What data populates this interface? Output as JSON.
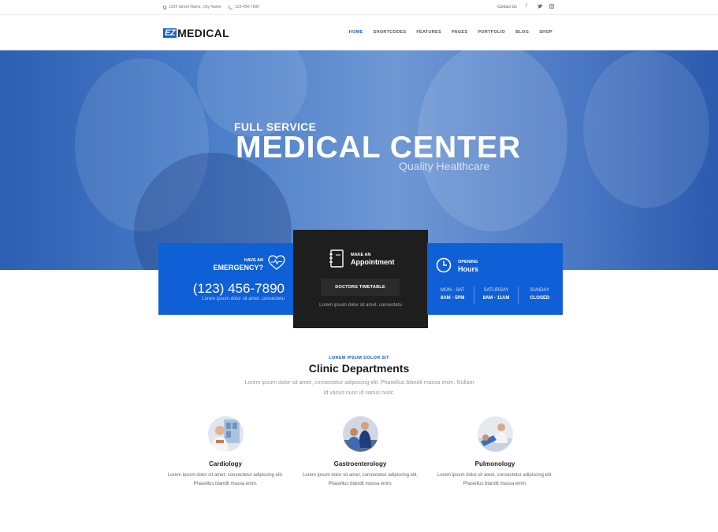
{
  "topbar": {
    "address": "1234 Street Name, City Name",
    "phone": "123-456-7890",
    "contact_label": "Contact Us",
    "social_icons": [
      "facebook-icon",
      "twitter-icon",
      "instagram-icon"
    ]
  },
  "header": {
    "logo_ez": "EZ",
    "logo_medical": "MEDICAL",
    "nav": [
      "HOME",
      "SHORTCODES",
      "FEATURES",
      "PAGES",
      "PORTFOLIO",
      "BLOG",
      "SHOP"
    ],
    "active_nav": "HOME"
  },
  "hero": {
    "subtitle": "FULL SERVICE",
    "title": "MEDICAL CENTER",
    "tagline": "Quality Healthcare"
  },
  "emergency": {
    "small": "HAVE AN",
    "big": "EMERGENCY?",
    "phone": "(123) 456-7890",
    "text": "Lorem ipsum dolor sit amet, consectetu"
  },
  "appointment": {
    "small": "MAKE AN",
    "big": "Appointment",
    "button": "DOCTORS TIMETABLE",
    "text": "Lorem ipsum dolor sit amet, consectetu"
  },
  "opening": {
    "small": "OPENING",
    "big": "Hours",
    "hours": [
      {
        "day": "MON - SAT",
        "time": "8AM - 5PM"
      },
      {
        "day": "SATURDAY",
        "time": "8AM - 11AM"
      },
      {
        "day": "SUNDAY",
        "time": "CLOSED"
      }
    ]
  },
  "departments": {
    "kicker": "LOREM IPSUM DOLOR SIT",
    "title": "Clinic Departments",
    "desc": "Lorem ipsum dolor sit amet, consectetur adipiscing elit. Phasellus blandit massa enim. Nullam id varius nunc id varius nunc.",
    "items": [
      {
        "name": "Cardiology",
        "text": "Lorem ipsum dolor sit amet, consectetur adipiscing elit. Phasellus blandit massa enim."
      },
      {
        "name": "Gastroenterology",
        "text": "Lorem ipsum dolor sit amet, consectetur adipiscing elit. Phasellus blandit massa enim."
      },
      {
        "name": "Pulmonology",
        "text": "Lorem ipsum dolor sit amet, consectetur adipiscing elit. Phasellus blandit massa enim."
      }
    ]
  },
  "colors": {
    "brand": "#0f5fd7",
    "dark_box": "#1e1e1e"
  }
}
